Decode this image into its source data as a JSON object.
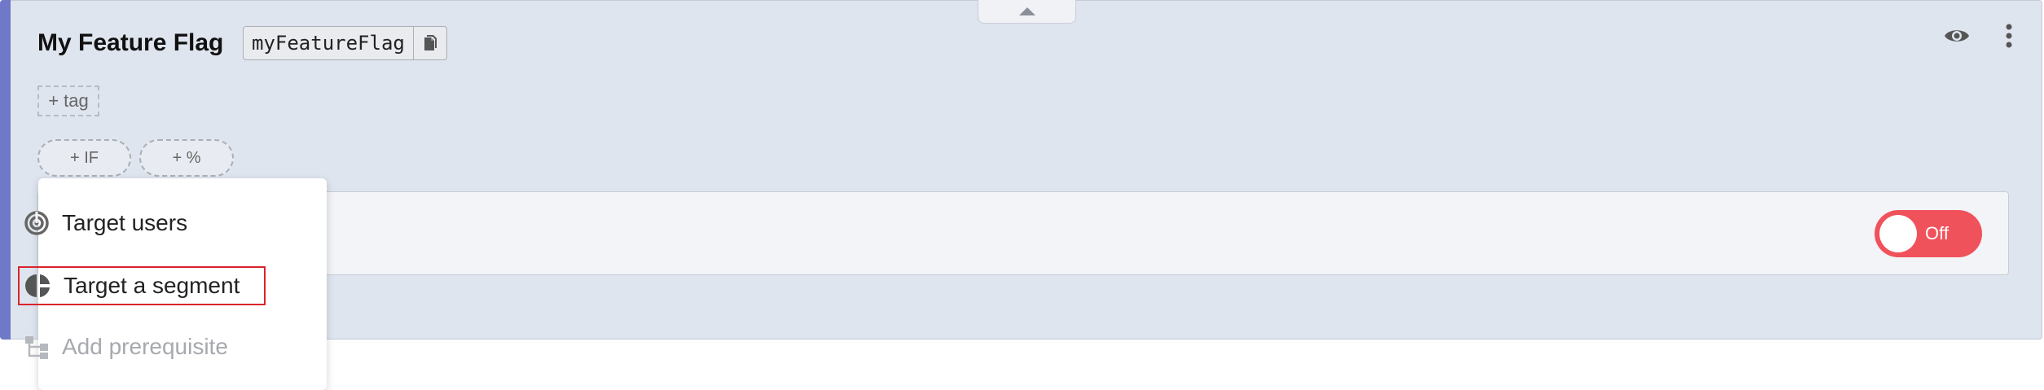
{
  "flag": {
    "title": "My Feature Flag",
    "key": "myFeatureFlag",
    "add_tag_label": "+ tag"
  },
  "rule_buttons": {
    "if_label": "+ IF",
    "percent_label": "+ %"
  },
  "toggle": {
    "label": "Off",
    "state": "off",
    "color": "#f0525b"
  },
  "menu": {
    "items": [
      {
        "label": "Target users",
        "icon": "target-icon",
        "enabled": true
      },
      {
        "label": "Target a segment",
        "icon": "pie-segment-icon",
        "enabled": true,
        "highlighted": true
      },
      {
        "label": "Add prerequisite",
        "icon": "hierarchy-icon",
        "enabled": false
      }
    ]
  },
  "icons": {
    "copy": "copy-icon",
    "visibility": "eye-icon",
    "more": "more-vertical-icon",
    "collapse": "caret-up-icon"
  },
  "colors": {
    "panel_bg": "#dfe5ef",
    "accent": "#7078c8",
    "highlight_border": "#d9242c"
  }
}
